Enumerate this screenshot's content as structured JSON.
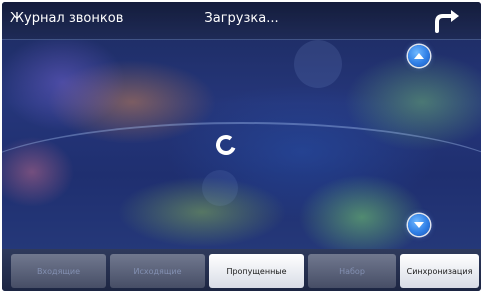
{
  "header": {
    "title": "Журнал звонков",
    "status": "Загрузка...",
    "back_icon": "back-arrow-icon"
  },
  "scroll": {
    "up_icon": "chevron-up-icon",
    "down_icon": "chevron-down-icon"
  },
  "loading": {
    "icon": "spinner-icon"
  },
  "tabs": [
    {
      "label": "Входящие",
      "enabled": false
    },
    {
      "label": "Исходящие",
      "enabled": false
    },
    {
      "label": "Пропущенные",
      "enabled": true
    },
    {
      "label": "Набор",
      "enabled": false
    },
    {
      "label": "Синхронизация",
      "enabled": true
    }
  ],
  "colors": {
    "accent_blue": "#2f7fe6",
    "header_bg": "#1c2a5e",
    "tab_disabled_text": "#8390b2"
  }
}
